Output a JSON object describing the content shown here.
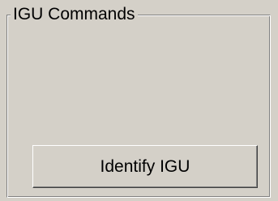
{
  "group": {
    "title": "IGU Commands"
  },
  "actions": {
    "identify_label": "Identify IGU"
  },
  "colors": {
    "face": "#d4d0c8",
    "shadow": "#808080",
    "highlight": "#ffffff",
    "text": "#000000"
  }
}
